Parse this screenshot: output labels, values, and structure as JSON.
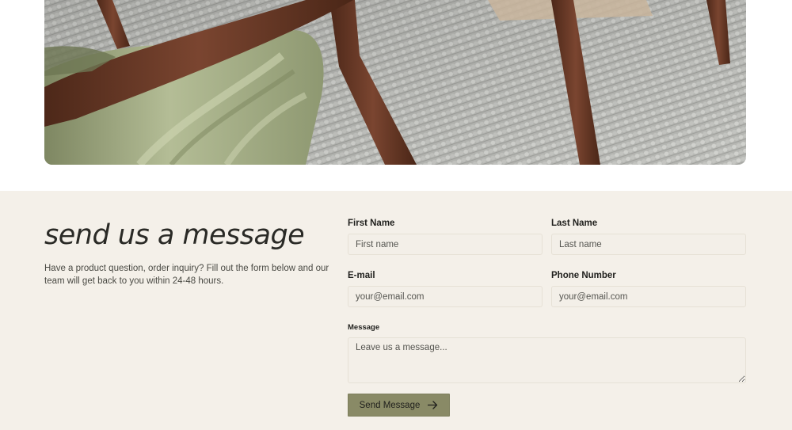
{
  "hero": {
    "image_alt": "Wooden chair with sage green upholstery on a textured grey rug",
    "colors": {
      "rug": "#b9bab6",
      "wood": "#6b3a26",
      "upholstery": "#aab48a"
    }
  },
  "contact": {
    "title": "send us a message",
    "description": "Have a product question, order inquiry? Fill out the form below and our team will get back to you within 24-48 hours.",
    "background": "#f4f0e9"
  },
  "form": {
    "first_name": {
      "label": "First Name",
      "placeholder": "First name",
      "value": ""
    },
    "last_name": {
      "label": "Last Name",
      "placeholder": "Last name",
      "value": ""
    },
    "email": {
      "label": "E-mail",
      "placeholder": "your@email.com",
      "value": ""
    },
    "phone": {
      "label": "Phone Number",
      "placeholder": "your@email.com",
      "value": ""
    },
    "message": {
      "label": "Message",
      "placeholder": "Leave us a message...",
      "value": ""
    },
    "submit": {
      "label": "Send Message",
      "icon": "arrow-right-icon",
      "color": "#898a66"
    }
  }
}
